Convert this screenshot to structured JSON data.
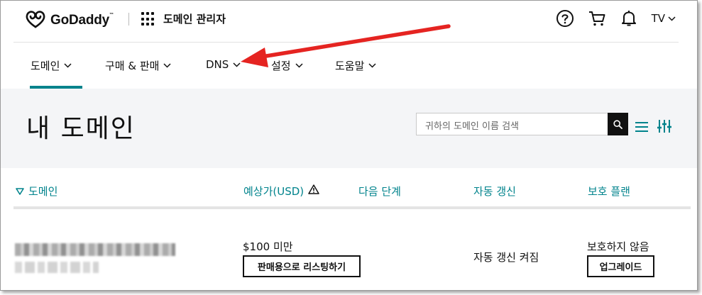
{
  "header": {
    "logo_text": "GoDaddy",
    "logo_tm": "™",
    "app_title": "도메인 관리자",
    "user_initials": "TV"
  },
  "nav": {
    "items": [
      {
        "label": "도메인",
        "active": true
      },
      {
        "label": "구매 & 판매"
      },
      {
        "label": "DNS"
      },
      {
        "label": "설정"
      },
      {
        "label": "도움말"
      }
    ]
  },
  "hero": {
    "title": "내 도메인",
    "search_placeholder": "귀하의 도메인 이름 검색"
  },
  "table": {
    "headers": {
      "domain": "도메인",
      "price": "예상가(USD)",
      "next_step": "다음 단계",
      "auto_renew": "자동 갱신",
      "protection": "보호 플랜"
    },
    "row": {
      "price": "$100 미만",
      "list_button": "판매용으로 리스팅하기",
      "auto_renew": "자동 갱신 켜짐",
      "protection": "보호하지 않음",
      "upgrade_button": "업그레이드"
    }
  },
  "colors": {
    "accent": "#00838c",
    "arrow": "#e52421",
    "band": "#f4f5f7"
  },
  "icons": [
    "godaddy-logo-icon",
    "apps-grid-icon",
    "help-icon",
    "cart-icon",
    "bell-icon",
    "chevron-down-icon",
    "search-icon",
    "list-view-icon",
    "filter-icon",
    "sort-down-icon",
    "warning-icon"
  ]
}
